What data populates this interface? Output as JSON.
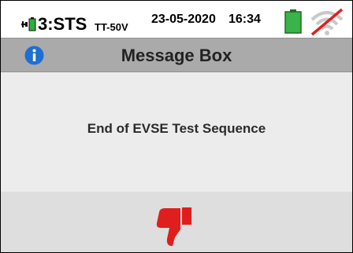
{
  "status": {
    "mode": "3:STS",
    "mode_sub": "TT-50V",
    "date": "23-05-2020",
    "time": "16:34",
    "icons": [
      "plug-battery-icon",
      "battery-icon",
      "wifi-off-icon"
    ],
    "battery_color": "#3ab34a",
    "wifi_off_color": "#e02020"
  },
  "title_bar": {
    "title": "Message Box",
    "icon": "info-icon",
    "icon_color": "#1f6fd0"
  },
  "message": {
    "text": "End of EVSE Test Sequence"
  },
  "result": {
    "icon": "thumbs-down-icon",
    "color": "#e01e1e"
  }
}
